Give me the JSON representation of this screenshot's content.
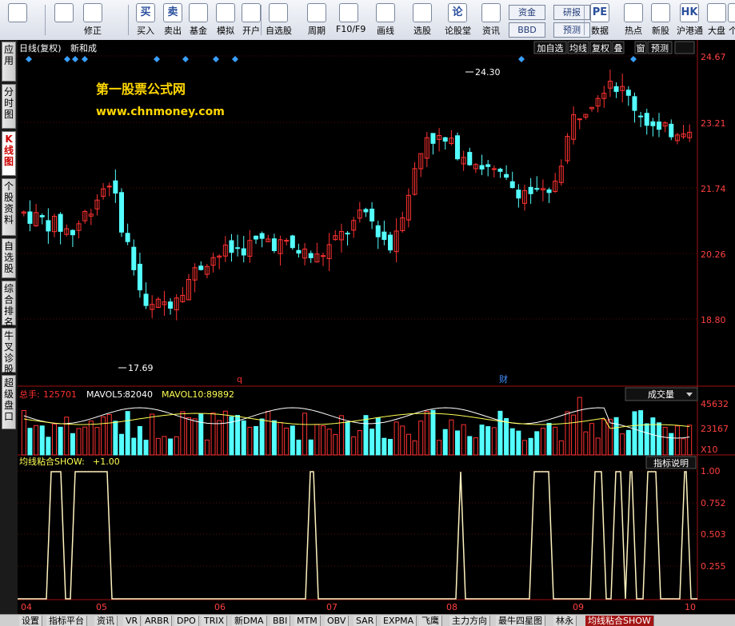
{
  "toolbar": {
    "buttons": [
      {
        "label": "",
        "icon": "windows-icon"
      },
      {
        "label": "",
        "icon": "back-arrow-icon"
      },
      {
        "label": "修正",
        "icon": "refresh-icon"
      },
      {
        "label": "买入",
        "icon": "buy-icon",
        "glyph": "买"
      },
      {
        "label": "卖出",
        "icon": "sell-icon",
        "glyph": "卖"
      },
      {
        "label": "基金",
        "icon": "fund-icon"
      },
      {
        "label": "模拟",
        "icon": "hammer-icon"
      },
      {
        "label": "开户",
        "icon": "lock-icon"
      },
      {
        "label": "自选股",
        "icon": "star-icon"
      },
      {
        "label": "周期",
        "icon": "clock-icon"
      },
      {
        "label": "F10/F9",
        "icon": "f10-icon"
      },
      {
        "label": "画线",
        "icon": "pencil-icon"
      },
      {
        "label": "选股",
        "icon": "screen-icon"
      },
      {
        "label": "论股堂",
        "icon": "forum-icon",
        "glyph": "论"
      },
      {
        "label": "资讯",
        "icon": "news-icon"
      },
      {
        "label": "数据",
        "icon": "pe-icon",
        "glyph": "PE"
      },
      {
        "label": "热点",
        "icon": "hot-icon"
      },
      {
        "label": "新股",
        "icon": "newstock-icon"
      },
      {
        "label": "沪港通",
        "icon": "hk-icon",
        "glyph": "HK"
      },
      {
        "label": "大盘",
        "icon": "market-icon"
      },
      {
        "label": "个股",
        "icon": "stock-icon"
      }
    ],
    "small_buttons": [
      "资金",
      "研报",
      "BBD",
      "预测"
    ]
  },
  "left_tabs": [
    {
      "label": "应用"
    },
    {
      "label": "分时图"
    },
    {
      "label": "K线图"
    },
    {
      "label": "个股资料"
    },
    {
      "label": "自选股"
    },
    {
      "label": "综合排名"
    },
    {
      "label": "牛叉诊股"
    },
    {
      "label": "超级盘口"
    }
  ],
  "header": {
    "period": "日线(复权)",
    "stock": "新和成",
    "right_buttons": [
      "加自选",
      "均线",
      "复权",
      "叠",
      "窗",
      "预测"
    ]
  },
  "watermark": {
    "line1": "第一股票公式网",
    "line2": "www.chnmoney.com"
  },
  "price_axis": [
    "24.67",
    "23.21",
    "21.74",
    "20.26",
    "18.80"
  ],
  "annotations": {
    "high": "24.30",
    "low": "17.69",
    "marker_q": "q",
    "marker_cai": "财"
  },
  "volume_panel": {
    "label_total": "总手: ",
    "total": "125701",
    "label_ma5": "MAVOL5: ",
    "ma5": "82040",
    "label_ma10": "MAVOL10: ",
    "ma10": "89892",
    "dropdown": "成交量",
    "axis": [
      "45632",
      "23167"
    ],
    "unit": "X10"
  },
  "indicator_panel": {
    "label": "均线粘合SHOW: ",
    "value": "+1.00",
    "help_button": "指标说明",
    "axis": [
      "1.00",
      "0.752",
      "0.503",
      "0.255"
    ]
  },
  "x_axis": [
    "04",
    "05",
    "06",
    "07",
    "08",
    "09",
    "10"
  ],
  "bottom_tabs": [
    "设置",
    "指标平台",
    "资讯",
    "VR",
    "ARBR",
    "DPO",
    "TRIX",
    "新DMA",
    "BBI",
    "MTM",
    "OBV",
    "SAR",
    "EXPMA",
    "飞鹰",
    "主力方向",
    "最牛四星图",
    "林永",
    "均线粘合SHOW"
  ],
  "colors": {
    "up": "#ff3232",
    "down": "#54ffff",
    "ma5": "#ffffff",
    "ma10": "#ffff54",
    "accent": "#a31515"
  }
}
